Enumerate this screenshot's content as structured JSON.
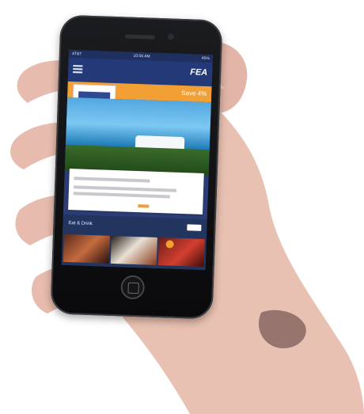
{
  "phone_ui": {
    "status_bar": {
      "carrier": "AT&T",
      "time": "10:56 AM",
      "battery": "45%"
    },
    "header": {
      "logo_text": "FEA"
    },
    "offer_banner": {
      "text": "Save 4%"
    },
    "sections": [
      {
        "title": "Eat & Drink"
      }
    ],
    "icons": [
      "hamburger-menu-icon",
      "logo-icon",
      "home-button-icon"
    ]
  }
}
